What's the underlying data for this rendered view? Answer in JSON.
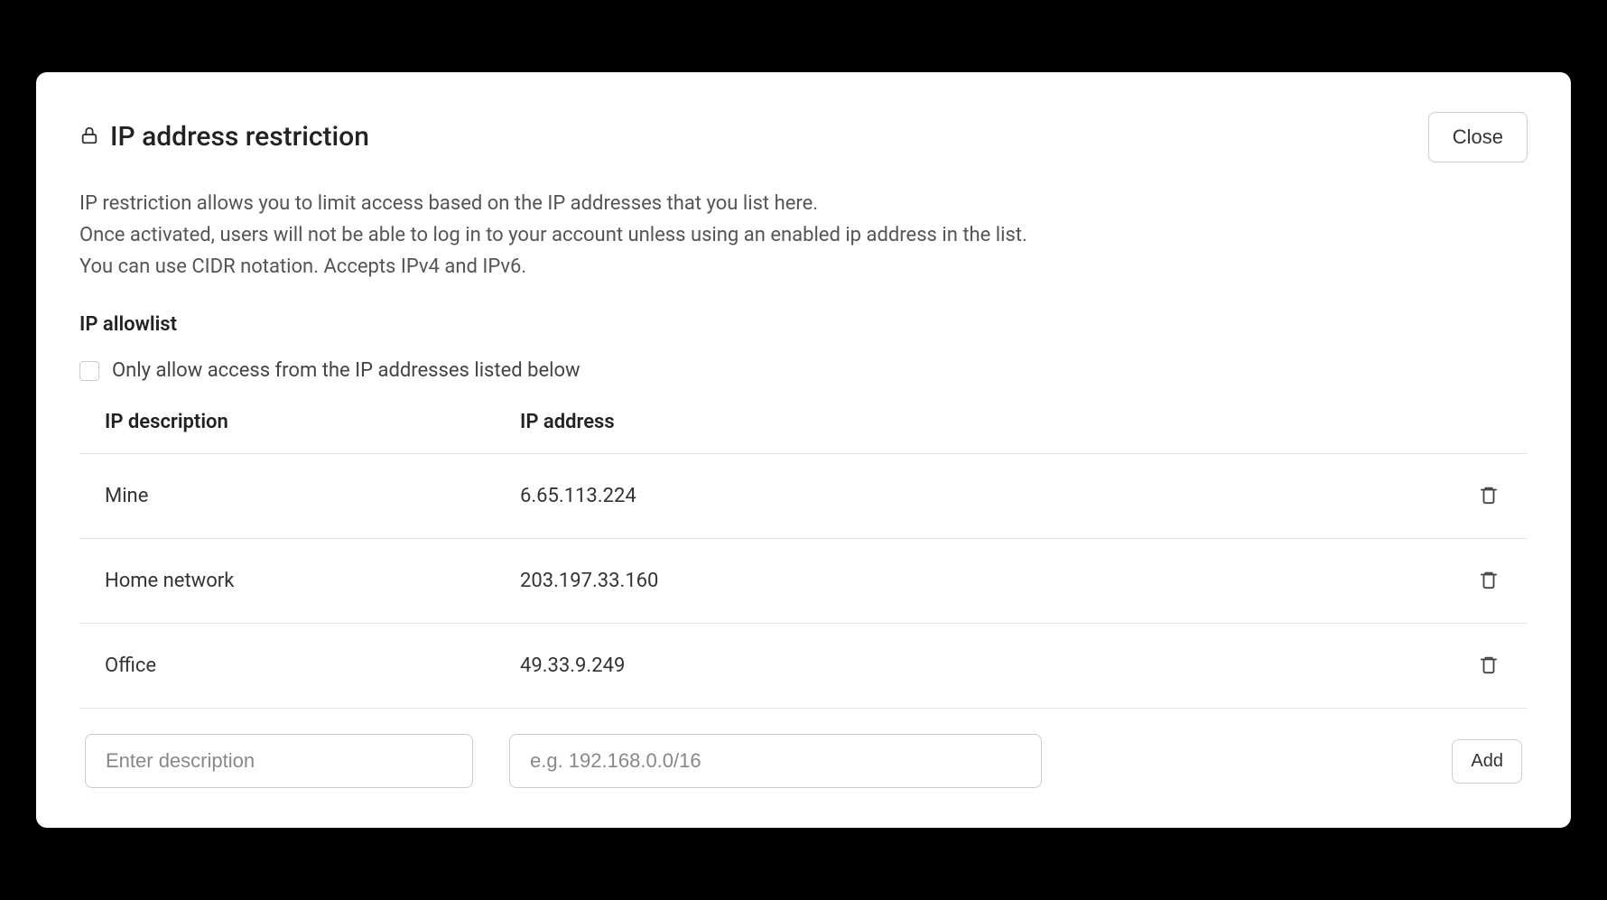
{
  "header": {
    "title": "IP address restriction",
    "close_label": "Close"
  },
  "description": {
    "line1": "IP restriction allows you to limit access based on the IP addresses that you list here.",
    "line2": "Once activated, users will not be able to log in to your account unless using an enabled ip address in the list.",
    "line3": "You can use CIDR notation. Accepts IPv4 and IPv6."
  },
  "allowlist": {
    "section_label": "IP allowlist",
    "checkbox_label": "Only allow access from the IP addresses listed below",
    "columns": {
      "description": "IP description",
      "address": "IP address"
    },
    "rows": [
      {
        "description": "Mine",
        "address": "6.65.113.224"
      },
      {
        "description": "Home network",
        "address": "203.197.33.160"
      },
      {
        "description": "Office",
        "address": "49.33.9.249"
      }
    ]
  },
  "form": {
    "description_placeholder": "Enter description",
    "address_placeholder": "e.g. 192.168.0.0/16",
    "add_label": "Add"
  }
}
